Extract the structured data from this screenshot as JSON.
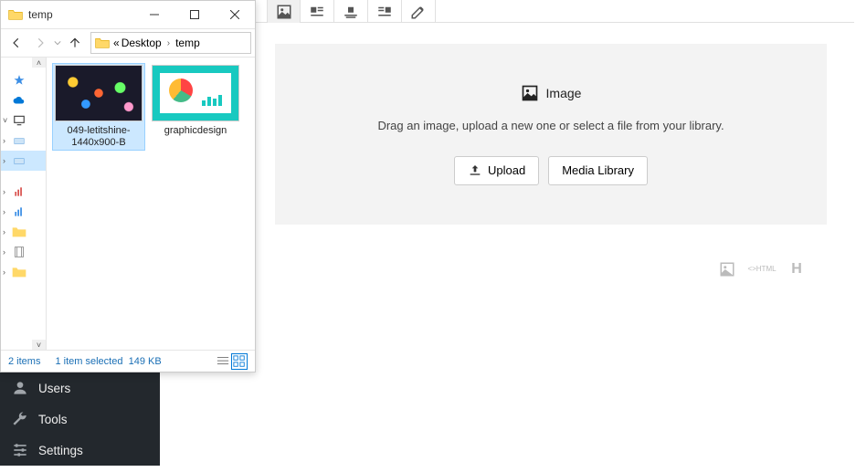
{
  "explorer": {
    "title": "temp",
    "breadcrumb": {
      "prefix": "«",
      "parts": [
        "Desktop",
        "temp"
      ]
    },
    "tree_items": [
      {
        "caret": "",
        "icon": "star",
        "color": "#3b8ee5"
      },
      {
        "caret": "",
        "icon": "cloud",
        "color": "#0078d7"
      },
      {
        "caret": "v",
        "icon": "monitor",
        "color": "#444"
      },
      {
        "caret": ">",
        "icon": "drive",
        "color": "#6aa7e0",
        "sel": false
      },
      {
        "caret": ">",
        "icon": "drive",
        "color": "#6aa7e0",
        "sel": true
      },
      {
        "caret": ">",
        "icon": "chart",
        "color": "#d9534f"
      },
      {
        "caret": ">",
        "icon": "chart",
        "color": "#3b8ee5"
      },
      {
        "caret": ">",
        "icon": "folder",
        "color": "#ffb900"
      },
      {
        "caret": ">",
        "icon": "film",
        "color": "#555"
      },
      {
        "caret": ">",
        "icon": "folder",
        "color": "#ffb900"
      }
    ],
    "files": [
      {
        "name": "049-letitshine-1440x900-B",
        "thumb": "bokeh",
        "selected": true
      },
      {
        "name": "graphicdesign",
        "thumb": "graphic",
        "selected": false
      }
    ],
    "status": {
      "count": "2 items",
      "selection": "1 item selected",
      "size": "149 KB"
    }
  },
  "editor": {
    "block": {
      "title": "Image",
      "instruction": "Drag an image, upload a new one or select a file from your library.",
      "upload_label": "Upload",
      "library_label": "Media Library"
    },
    "footer_html_label": "HTML",
    "footer_h": "H"
  },
  "wp_menu": [
    {
      "label": "Users",
      "icon": "user"
    },
    {
      "label": "Tools",
      "icon": "wrench"
    },
    {
      "label": "Settings",
      "icon": "sliders"
    }
  ]
}
